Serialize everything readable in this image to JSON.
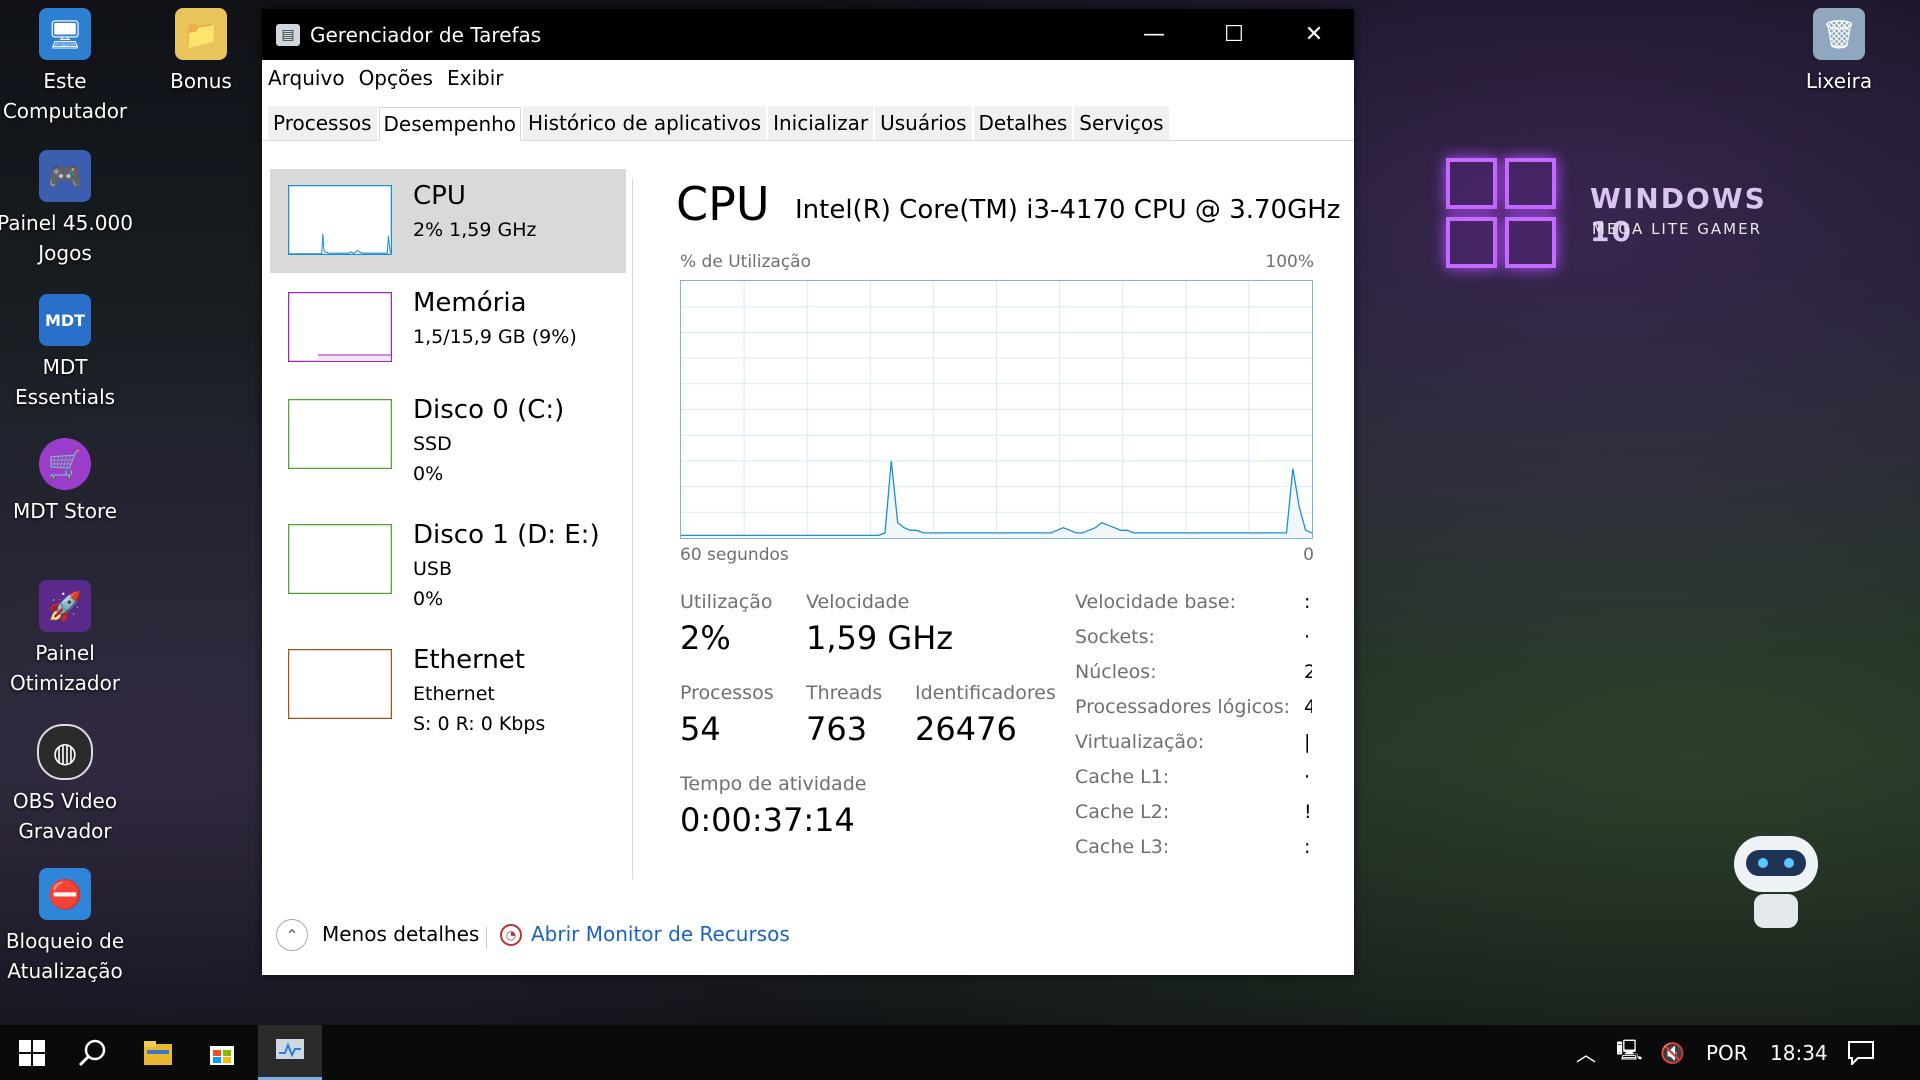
{
  "desktop": {
    "icons": [
      {
        "label": "Este\nComputador",
        "icon": "computer-icon"
      },
      {
        "label": "Bonus",
        "icon": "folder-icon"
      },
      {
        "label": "Painel 45.000\nJogos",
        "icon": "gamepad-icon"
      },
      {
        "label": "MDT\nEssentials",
        "icon": "mdt-icon"
      },
      {
        "label": "MDT Store",
        "icon": "store-cart-icon"
      },
      {
        "label": "Painel\nOtimizador",
        "icon": "rocket-icon"
      },
      {
        "label": "OBS Video\nGravador",
        "icon": "obs-icon"
      },
      {
        "label": "Bloqueio de\nAtualização",
        "icon": "update-block-icon"
      },
      {
        "label": "Lixeira",
        "icon": "recycle-bin-icon"
      }
    ],
    "brand": {
      "title": "WINDOWS 10",
      "subtitle": "MEGA LITE GAMER",
      "accent": "#c46bff"
    }
  },
  "window": {
    "title": "Gerenciador de Tarefas",
    "controls": {
      "minimize": "—",
      "maximize": "☐",
      "close": "✕"
    },
    "menu": [
      "Arquivo",
      "Opções",
      "Exibir"
    ],
    "tabs": [
      "Processos",
      "Desempenho",
      "Histórico de aplicativos",
      "Inicializar",
      "Usuários",
      "Detalhes",
      "Serviços"
    ],
    "active_tab": "Desempenho",
    "resources": [
      {
        "name": "CPU",
        "line2": "2%  1,59 GHz",
        "line3": "",
        "color": "#1a8fd6",
        "selected": true
      },
      {
        "name": "Memória",
        "line2": "1,5/15,9 GB (9%)",
        "line3": "",
        "color": "#9b28b6",
        "selected": false
      },
      {
        "name": "Disco 0 (C:)",
        "line2": "SSD",
        "line3": "0%",
        "color": "#4da72d",
        "selected": false
      },
      {
        "name": "Disco 1 (D: E:)",
        "line2": "USB",
        "line3": "0%",
        "color": "#4da72d",
        "selected": false
      },
      {
        "name": "Ethernet",
        "line2": "Ethernet",
        "line3": "S: 0  R: 0 Kbps",
        "color": "#a7531a",
        "selected": false
      }
    ],
    "detail": {
      "title": "CPU",
      "model": "Intel(R) Core(TM) i3-4170 CPU @ 3.70GHz",
      "graph": {
        "ylabel": "% de Utilização",
        "ymax": "100%",
        "xlabel": "60 segundos",
        "xmin": "0",
        "usage_percent": [
          1,
          1,
          1,
          1,
          1,
          1,
          1,
          1,
          1,
          1,
          1,
          1,
          1,
          1,
          1,
          1,
          1,
          1,
          1,
          1,
          1,
          1,
          1,
          1,
          1,
          1,
          1,
          1,
          1,
          1,
          1,
          1,
          2,
          30,
          6,
          4,
          3,
          3,
          2,
          2,
          2,
          2,
          2,
          2,
          2,
          2,
          2,
          2,
          2,
          2,
          2,
          2,
          2,
          2,
          2,
          2,
          2,
          2,
          2,
          3,
          4,
          3,
          2,
          2,
          3,
          4,
          6,
          5,
          4,
          3,
          3,
          2,
          2,
          2,
          2,
          2,
          2,
          2,
          2,
          2,
          2,
          2,
          2,
          2,
          2,
          2,
          2,
          2,
          2,
          2,
          2,
          2,
          2,
          2,
          2,
          2,
          27,
          12,
          3,
          2
        ]
      },
      "stats": {
        "utilizacao": {
          "label": "Utilização",
          "value": "2%"
        },
        "velocidade": {
          "label": "Velocidade",
          "value": "1,59 GHz"
        },
        "processos": {
          "label": "Processos",
          "value": "54"
        },
        "threads": {
          "label": "Threads",
          "value": "763"
        },
        "identificadores": {
          "label": "Identificadores",
          "value": "26476"
        },
        "tempo": {
          "label": "Tempo de atividade",
          "value": "0:00:37:14"
        }
      },
      "specs": [
        {
          "label": "Velocidade base:",
          "value": ":"
        },
        {
          "label": "Sockets:",
          "value": "·"
        },
        {
          "label": "Núcleos:",
          "value": "2"
        },
        {
          "label": "Processadores lógicos:",
          "value": "4"
        },
        {
          "label": "Virtualização:",
          "value": "|"
        },
        {
          "label": "Cache L1:",
          "value": "·"
        },
        {
          "label": "Cache L2:",
          "value": "!"
        },
        {
          "label": "Cache L3:",
          "value": ":"
        }
      ]
    },
    "footer": {
      "less_details": "Menos detalhes",
      "open_monitor": "Abrir Monitor de Recursos"
    }
  },
  "taskbar": {
    "items": [
      "start-icon",
      "search-icon",
      "file-explorer-icon",
      "store-icon",
      "task-manager-icon"
    ],
    "language": "POR",
    "time": "18:34"
  }
}
